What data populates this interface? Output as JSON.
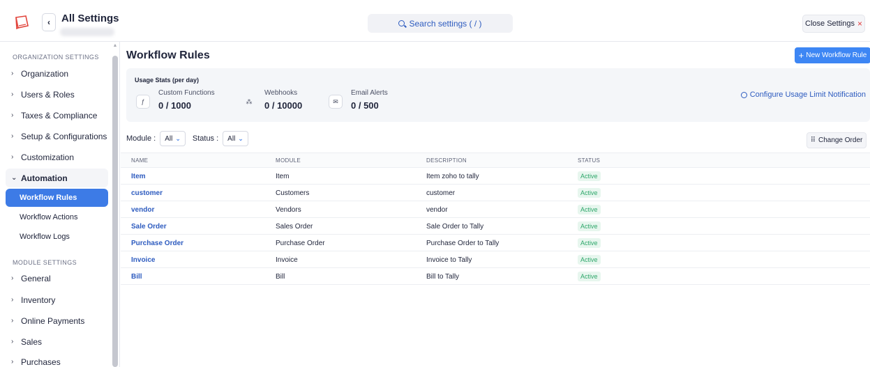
{
  "header": {
    "title": "All Settings",
    "search_label": "Search settings ( / )",
    "close_label": "Close Settings",
    "close_symbol": "×"
  },
  "sidebar": {
    "org_section": "ORGANIZATION SETTINGS",
    "org_items": [
      "Organization",
      "Users & Roles",
      "Taxes & Compliance",
      "Setup & Configurations",
      "Customization"
    ],
    "automation_label": "Automation",
    "automation_sub": [
      "Workflow Rules",
      "Workflow Actions",
      "Workflow Logs"
    ],
    "module_section": "MODULE SETTINGS",
    "module_items": [
      "General",
      "Inventory",
      "Online Payments",
      "Sales",
      "Purchases"
    ]
  },
  "main": {
    "title": "Workflow Rules",
    "new_button": "New Workflow Rule",
    "usage_title": "Usage Stats (per day)",
    "stats": [
      {
        "label": "Custom Functions",
        "value": "0 / 1000"
      },
      {
        "label": "Webhooks",
        "value": "0 / 10000"
      },
      {
        "label": "Email Alerts",
        "value": "0 / 500"
      }
    ],
    "config_link": "Configure Usage Limit Notification",
    "filters": {
      "module_label": "Module :",
      "module_value": "All",
      "status_label": "Status :",
      "status_value": "All"
    },
    "change_order": "Change Order",
    "columns": [
      "NAME",
      "MODULE",
      "DESCRIPTION",
      "STATUS"
    ],
    "rows": [
      {
        "name": "Item",
        "module": "Item",
        "description": "Item zoho to tally",
        "status": "Active"
      },
      {
        "name": "customer",
        "module": "Customers",
        "description": "customer",
        "status": "Active"
      },
      {
        "name": "vendor",
        "module": "Vendors",
        "description": "vendor",
        "status": "Active"
      },
      {
        "name": "Sale Order",
        "module": "Sales Order",
        "description": "Sale Order to Tally",
        "status": "Active"
      },
      {
        "name": "Purchase Order",
        "module": "Purchase Order",
        "description": "Purchase Order to Tally",
        "status": "Active"
      },
      {
        "name": "Invoice",
        "module": "Invoice",
        "description": "Invoice to Tally",
        "status": "Active"
      },
      {
        "name": "Bill",
        "module": "Bill",
        "description": "Bill to Tally",
        "status": "Active"
      }
    ]
  },
  "colors": {
    "accent": "#3d7be6",
    "link": "#2d5bbf",
    "active_status": "#2ea76a",
    "close_x": "#e13b3b"
  }
}
